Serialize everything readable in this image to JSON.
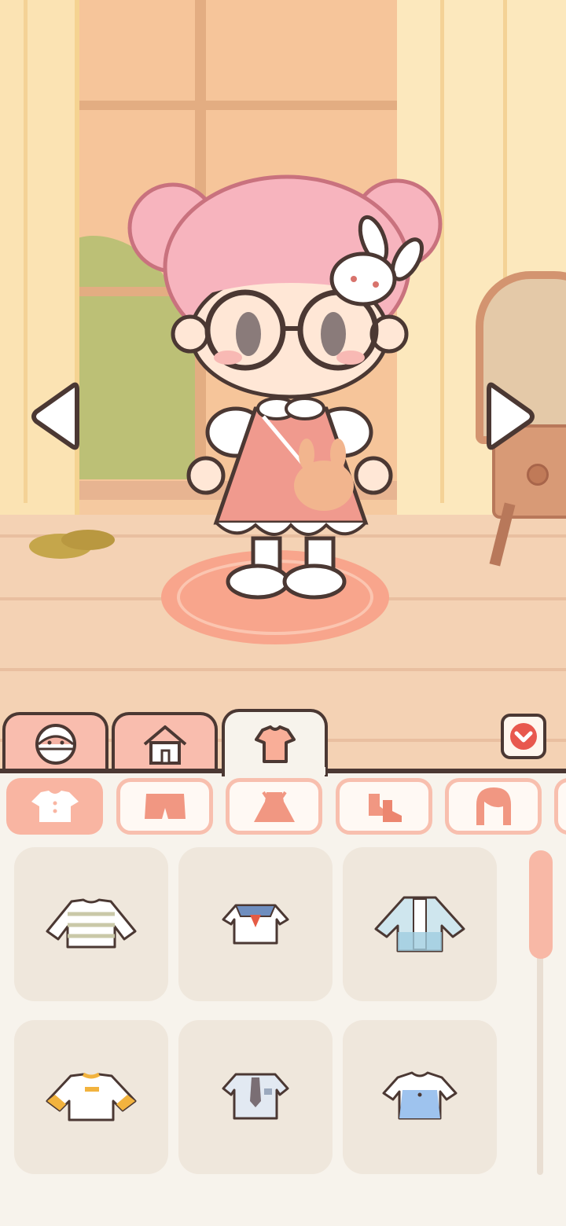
{
  "scene": {
    "description_colors": {
      "wall": "#F5C9A0",
      "floor": "#F4D2B4",
      "rug": "#F8A58C",
      "curtain": "#FBE3B3"
    }
  },
  "character": {
    "hair_color": "#F7B4BE",
    "dress_color": "#F09A8E",
    "accessories": [
      "round-glasses",
      "bunny-hairclip",
      "bunny-bag"
    ]
  },
  "navigation": {
    "prev_icon": "left-triangle-arrow-icon",
    "next_icon": "right-triangle-arrow-icon"
  },
  "tabs": [
    {
      "id": "character",
      "icon": "face-icon",
      "active": false
    },
    {
      "id": "room",
      "icon": "house-icon",
      "active": false
    },
    {
      "id": "clothes",
      "icon": "shirt-icon",
      "active": true
    }
  ],
  "collapse_icon": "chevron-down-icon",
  "subcategories": [
    {
      "id": "tops",
      "icon": "tshirt-icon",
      "selected": true
    },
    {
      "id": "bottoms",
      "icon": "shorts-icon",
      "selected": false
    },
    {
      "id": "dresses",
      "icon": "dress-icon",
      "selected": false
    },
    {
      "id": "shoes",
      "icon": "shoes-icon",
      "selected": false
    },
    {
      "id": "hair",
      "icon": "hair-icon",
      "selected": false
    }
  ],
  "items": [
    {
      "id": "striped-long-sleeve",
      "icon": "striped-shirt-icon"
    },
    {
      "id": "sailor-top",
      "icon": "sailor-shirt-icon"
    },
    {
      "id": "blue-open-jacket",
      "icon": "open-jacket-icon"
    },
    {
      "id": "yellow-sleeve-tee",
      "icon": "yellow-tee-icon"
    },
    {
      "id": "uniform-tie-shirt",
      "icon": "tie-shirt-icon"
    },
    {
      "id": "blue-vest-top",
      "icon": "blue-top-icon"
    }
  ],
  "colors": {
    "accent": "#F9B5A2",
    "outline": "#4B3833",
    "panel": "#F7F3EC",
    "slot": "#EFE7DC"
  }
}
